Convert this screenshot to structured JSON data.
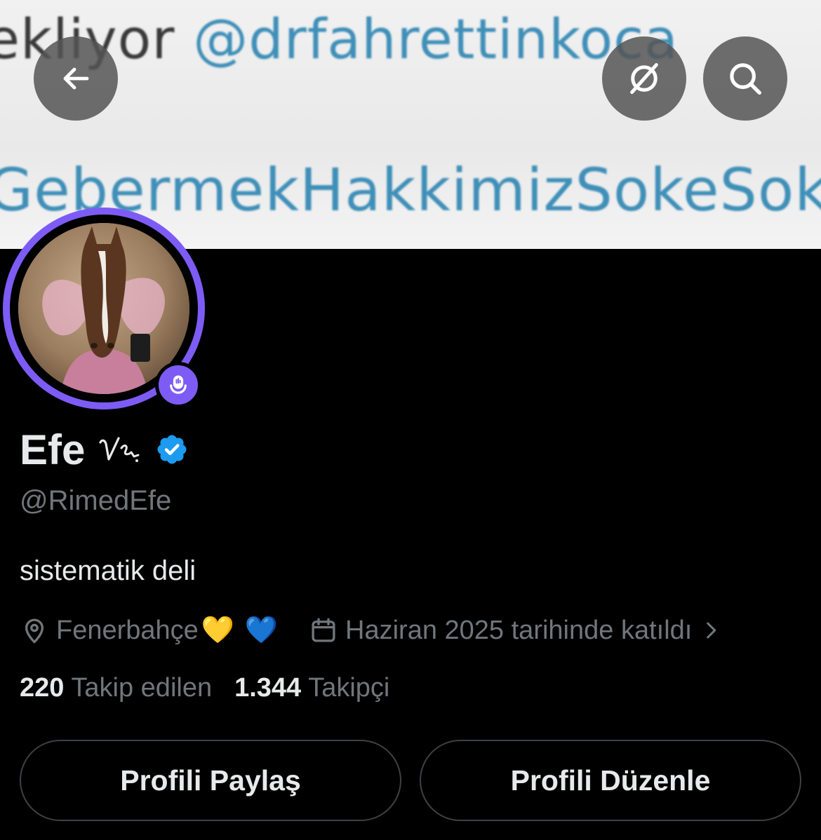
{
  "banner": {
    "line1_prefix": "ekliyor ",
    "line1_mention": "@drfahrettinkoca",
    "line2": "GebermekHakkimizSokeSokeA"
  },
  "topbar": {
    "back_icon": "arrow-left-icon",
    "grok_icon": "grok-slash-circle-icon",
    "search_icon": "search-icon"
  },
  "profile": {
    "display_name": "Efe",
    "name_badge_text": "V",
    "verified_color": "#1d9bf0",
    "handle": "@RimedEfe",
    "bio": "sistematik deli",
    "location": "Fenerbahçe",
    "location_emojis": [
      "💛",
      "💙"
    ],
    "joined": "Haziran 2025 tarihinde katıldı",
    "following_count": "220",
    "following_label": "Takip edilen",
    "followers_count": "1.344",
    "followers_label": "Takipçi"
  },
  "actions": {
    "share_label": "Profili Paylaş",
    "edit_label": "Profili Düzenle"
  },
  "colors": {
    "accent_ring": "#7d5cf5",
    "background": "#000000",
    "muted_text": "#71767b",
    "primary_text": "#e7e9ea"
  }
}
